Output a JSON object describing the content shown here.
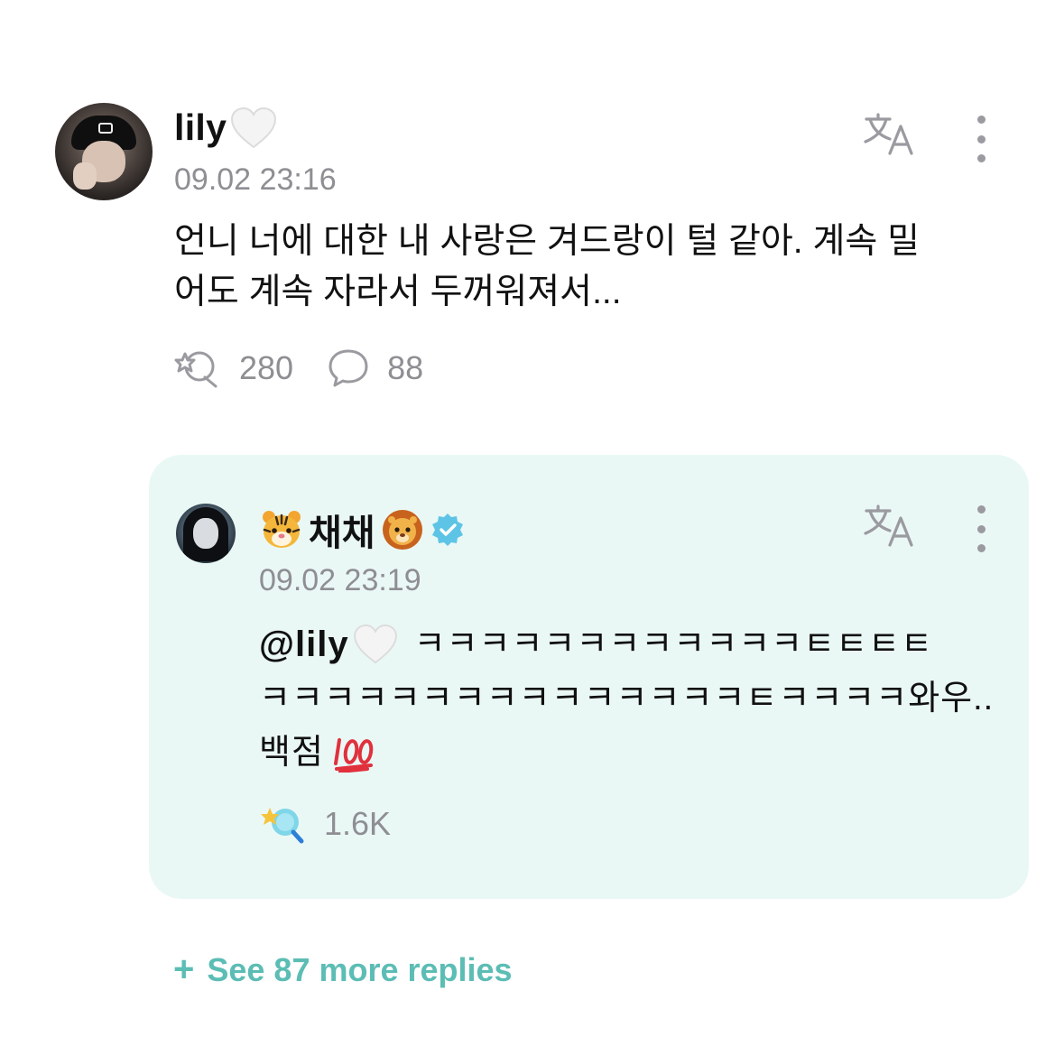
{
  "comment": {
    "username": "lily",
    "username_suffix_emoji": "white-heart",
    "timestamp": "09.02 23:16",
    "text_line1": "언니 너에 대한 내 사랑은 겨드랑이 털 같아. 계속 밀",
    "text_line2": "어도 계속 자라서 두꺼워져서...",
    "like_count": "280",
    "reply_count": "88",
    "icons": [
      "translate-icon",
      "more-icon",
      "like-icon",
      "reply-icon"
    ]
  },
  "reply": {
    "username": "채채",
    "prefix_emoji": "tiger-face",
    "suffix_emoji": "lion-face",
    "verified": true,
    "timestamp": "09.02 23:19",
    "mention": "@lily",
    "text_line1": "ㅋㅋㅋㅋㅋㅋㅋㅋㅋㅋㅋㅋㅌㅌㅌㅌ",
    "text_line2": "ㅋㅋㅋㅋㅋㅋㅋㅋㅋㅋㅋㅋㅋㅋㅋㅌㅋㅋㅋㅋ와우..",
    "text_line3": "백점",
    "text_line3_emoji": "hundred-points",
    "like_count": "1.6K",
    "icons": [
      "translate-icon",
      "more-icon",
      "like-icon"
    ]
  },
  "see_more": {
    "label": "See 87 more replies"
  },
  "colors": {
    "card_bg": "#eaf8f5",
    "accent": "#5cbdb5",
    "meta_gray": "#8e8e93",
    "verified_blue": "#5ec4e6"
  }
}
